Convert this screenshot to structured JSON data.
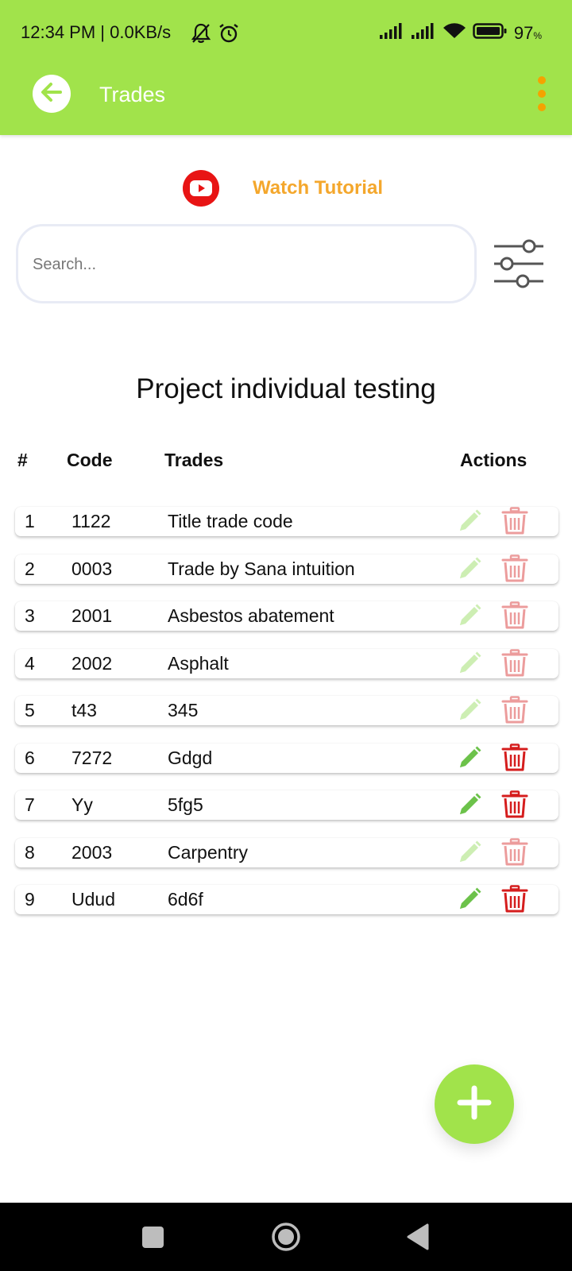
{
  "status_bar": {
    "time_network": "12:34 PM | 0.0KB/s",
    "battery": "97",
    "battery_unit": "%",
    "icons": [
      "bell-off-icon",
      "alarm-icon",
      "signal-icon",
      "signal-icon",
      "wifi-icon",
      "battery-icon"
    ]
  },
  "app_bar": {
    "title": "Trades",
    "back_icon": "arrow-left-icon",
    "menu_icon": "more-vertical-icon"
  },
  "tutorial": {
    "label": "Watch Tutorial",
    "icon": "youtube-icon"
  },
  "search": {
    "placeholder": "Search...",
    "value": "",
    "filter_icon": "sliders-icon"
  },
  "project_title": "Project individual testing",
  "table": {
    "headers": {
      "num": "#",
      "code": "Code",
      "trades": "Trades",
      "actions": "Actions"
    },
    "rows": [
      {
        "num": "1",
        "code": "1122",
        "trade": "Title trade code",
        "enabled": false
      },
      {
        "num": "2",
        "code": "0003",
        "trade": "Trade by Sana intuition",
        "enabled": false
      },
      {
        "num": "3",
        "code": "2001",
        "trade": "Asbestos abatement",
        "enabled": false
      },
      {
        "num": "4",
        "code": "2002",
        "trade": "Asphalt",
        "enabled": false
      },
      {
        "num": "5",
        "code": "t43",
        "trade": "345",
        "enabled": false
      },
      {
        "num": "6",
        "code": "7272",
        "trade": "Gdgd",
        "enabled": true
      },
      {
        "num": "7",
        "code": "Yy",
        "trade": "5fg5",
        "enabled": true
      },
      {
        "num": "8",
        "code": "2003",
        "trade": "Carpentry",
        "enabled": false
      },
      {
        "num": "9",
        "code": "Udud",
        "trade": "6d6f",
        "enabled": true
      }
    ],
    "action_icons": [
      "pencil-icon",
      "trash-icon"
    ]
  },
  "fab": {
    "icon": "plus-icon"
  },
  "nav_bar": {
    "icons": [
      "recent-apps-icon",
      "home-icon",
      "back-triangle-icon"
    ]
  },
  "colors": {
    "brand_green": "#a1e34b",
    "accent_orange": "#f4a72c",
    "menu_orange": "#f4a300",
    "youtube_red": "#e81414",
    "edit_green_active": "#6cc24a",
    "edit_green_muted": "#cdeeb3",
    "delete_red_active": "#d51d1d",
    "delete_red_muted": "#ec9c9c"
  }
}
